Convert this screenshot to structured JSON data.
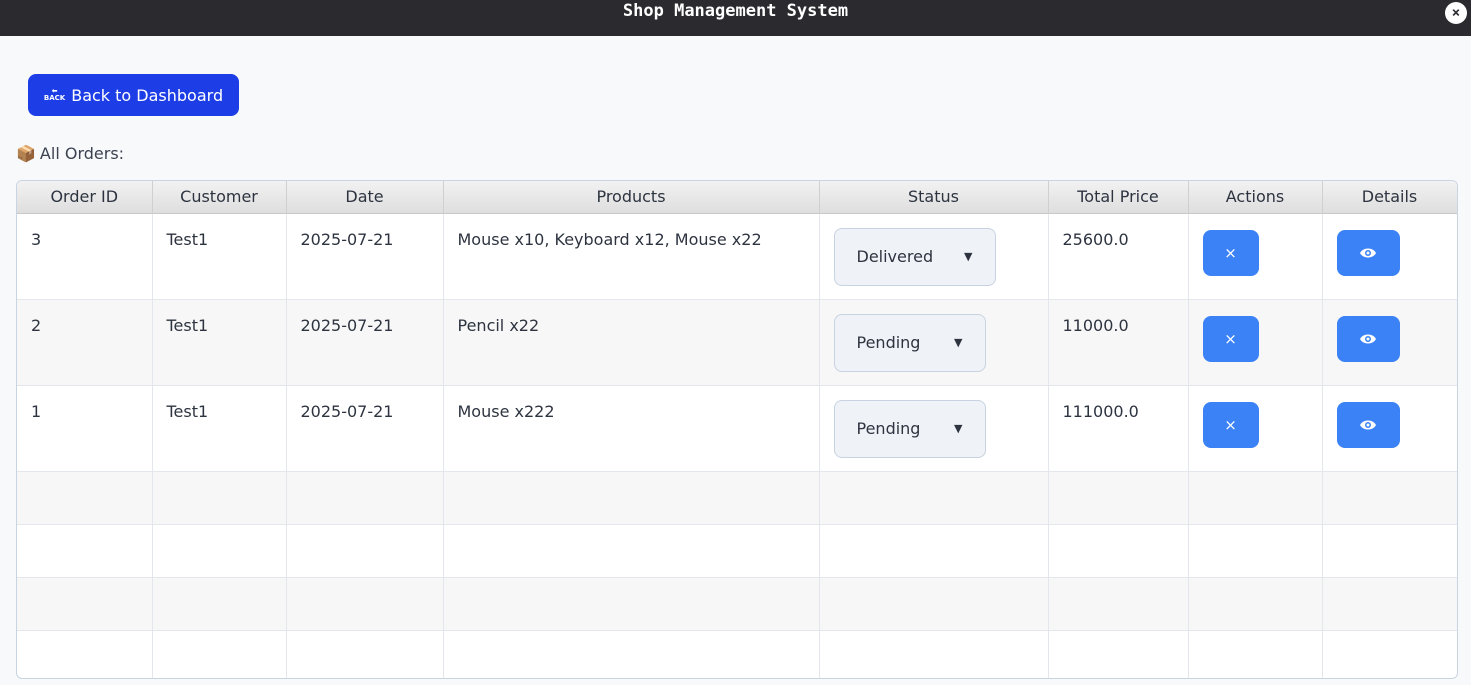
{
  "window": {
    "title": "Shop Management System",
    "close": "×"
  },
  "back_button": {
    "label": "Back to Dashboard",
    "icon_text": "BACK"
  },
  "section_label": "All Orders:",
  "table": {
    "headers": [
      "Order ID",
      "Customer",
      "Date",
      "Products",
      "Status",
      "Total Price",
      "Actions",
      "Details"
    ],
    "rows": [
      {
        "id": "3",
        "customer": "Test1",
        "date": "2025-07-21",
        "products": "Mouse x10, Keyboard x12, Mouse x22",
        "status": "Delivered",
        "total": "25600.0"
      },
      {
        "id": "2",
        "customer": "Test1",
        "date": "2025-07-21",
        "products": "Pencil x22",
        "status": "Pending",
        "total": "11000.0"
      },
      {
        "id": "1",
        "customer": "Test1",
        "date": "2025-07-21",
        "products": "Mouse x222",
        "status": "Pending",
        "total": "111000.0"
      }
    ],
    "delete_icon": "×",
    "accent": "#3b82f6"
  }
}
